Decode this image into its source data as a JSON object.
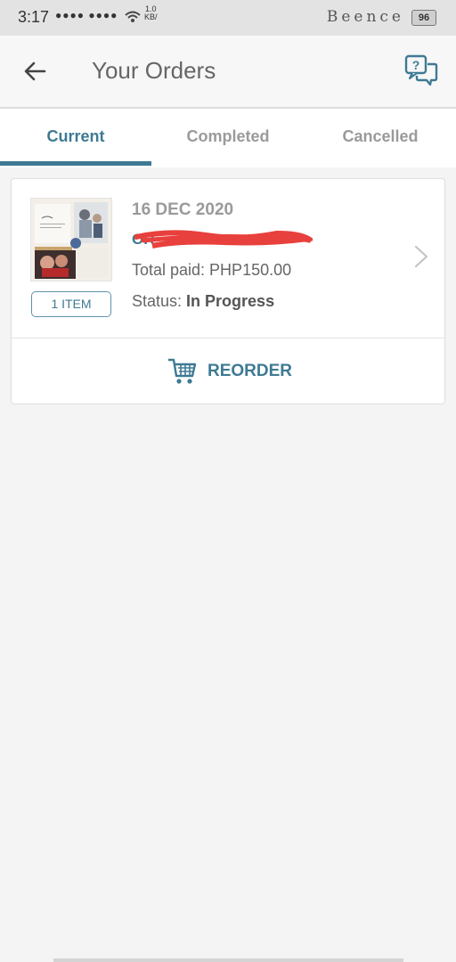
{
  "status_bar": {
    "time": "3:17",
    "speed_value": "1.0",
    "speed_unit": "KB/",
    "carrier": "Beence",
    "battery": "96"
  },
  "app_bar": {
    "title": "Your Orders",
    "back_icon": "arrow-left-icon",
    "help_icon": "chat-question-icon"
  },
  "tabs": [
    {
      "label": "Current",
      "active": true
    },
    {
      "label": "Completed",
      "active": false
    },
    {
      "label": "Cancelled",
      "active": false
    }
  ],
  "order": {
    "date": "16 DEC 2020",
    "order_id_visible": "OR",
    "total_paid": "Total paid: PHP150.00",
    "status_label": "Status:",
    "status_value": "In Progress",
    "items_badge": "1 ITEM",
    "reorder_label": "REORDER"
  },
  "colors": {
    "accent": "#3e7a93",
    "redaction": "#e8403c",
    "muted_text": "#9a9a9a"
  }
}
